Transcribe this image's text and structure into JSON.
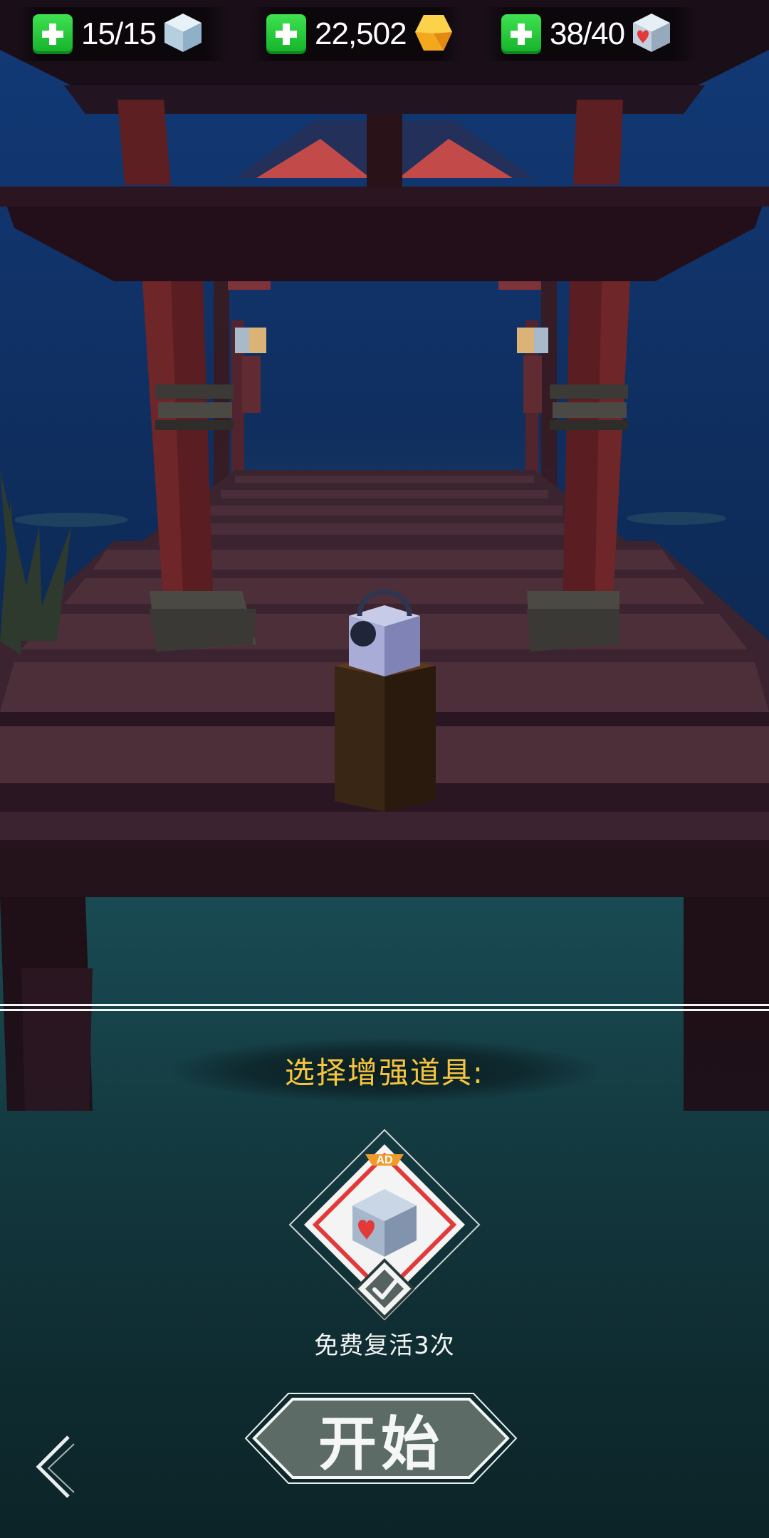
{
  "resources": [
    {
      "id": "energy",
      "value": "15/15",
      "icon": "ice-cube-icon"
    },
    {
      "id": "gems",
      "value": "22,502",
      "icon": "gold-gem-icon"
    },
    {
      "id": "revive",
      "value": "38/40",
      "icon": "heart-cube-icon"
    }
  ],
  "booster": {
    "title": "选择增强道具:",
    "badge": "AD",
    "label": "免费复活3次",
    "icon": "heart-cube-icon",
    "selected": true
  },
  "start_label": "开始",
  "colors": {
    "accent_gold": "#f6c53f",
    "plus_green": "#1fc132",
    "button_fill": "#5c6b66",
    "ad_badge": "#f09a2a",
    "frame_red": "#e23a3a"
  }
}
